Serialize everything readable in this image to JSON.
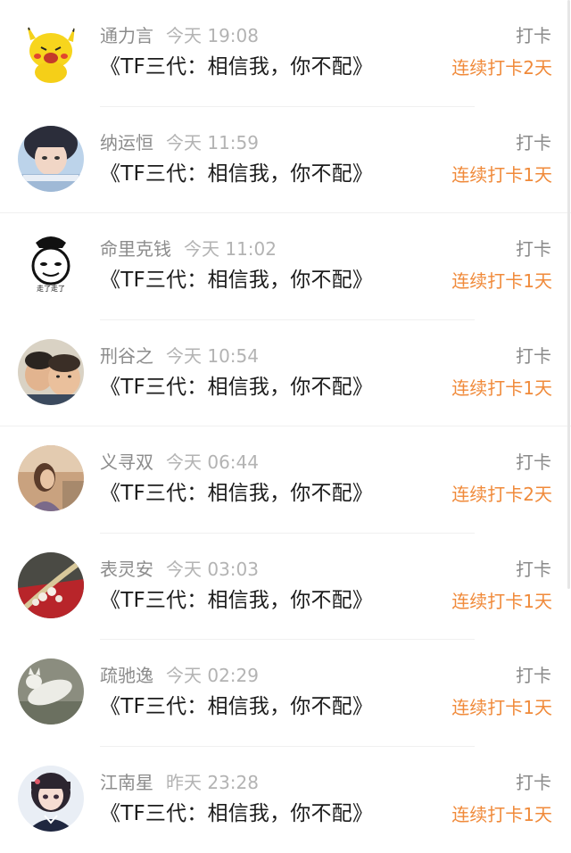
{
  "entries": [
    {
      "name": "通力言",
      "time": "今天 19:08",
      "title": "《TF三代：相信我，你不配》",
      "action": "打卡",
      "streak": "连续打卡2天",
      "avatar": "pikachu-avatar"
    },
    {
      "name": "纳运恒",
      "time": "今天 11:59",
      "title": "《TF三代：相信我，你不配》",
      "action": "打卡",
      "streak": "连续打卡1天",
      "avatar": "girl-selfie-avatar"
    },
    {
      "name": "命里克钱",
      "time": "今天 11:02",
      "title": "《TF三代：相信我，你不配》",
      "action": "打卡",
      "streak": "连续打卡1天",
      "avatar": "meme-face-avatar",
      "avatar_text": "走了走了"
    },
    {
      "name": "刑谷之",
      "time": "今天 10:54",
      "title": "《TF三代：相信我，你不配》",
      "action": "打卡",
      "streak": "连续打卡1天",
      "avatar": "two-boys-avatar"
    },
    {
      "name": "义寻双",
      "time": "今天 06:44",
      "title": "《TF三代：相信我，你不配》",
      "action": "打卡",
      "streak": "连续打卡2天",
      "avatar": "girl-profile-avatar"
    },
    {
      "name": "表灵安",
      "time": "今天 03:03",
      "title": "《TF三代：相信我，你不配》",
      "action": "打卡",
      "streak": "连续打卡1天",
      "avatar": "pearl-brooch-avatar"
    },
    {
      "name": "疏驰逸",
      "time": "今天 02:29",
      "title": "《TF三代：相信我，你不配》",
      "action": "打卡",
      "streak": "连续打卡1天",
      "avatar": "white-cat-avatar"
    },
    {
      "name": "江南星",
      "time": "昨天 23:28",
      "title": "《TF三代：相信我，你不配》",
      "action": "打卡",
      "streak": "连续打卡1天",
      "avatar": "anime-girl-avatar"
    }
  ],
  "colors": {
    "streak": "#f08a3a",
    "meta": "#8a8a8a",
    "time": "#b3b3b3",
    "title": "#1c1c1c"
  }
}
